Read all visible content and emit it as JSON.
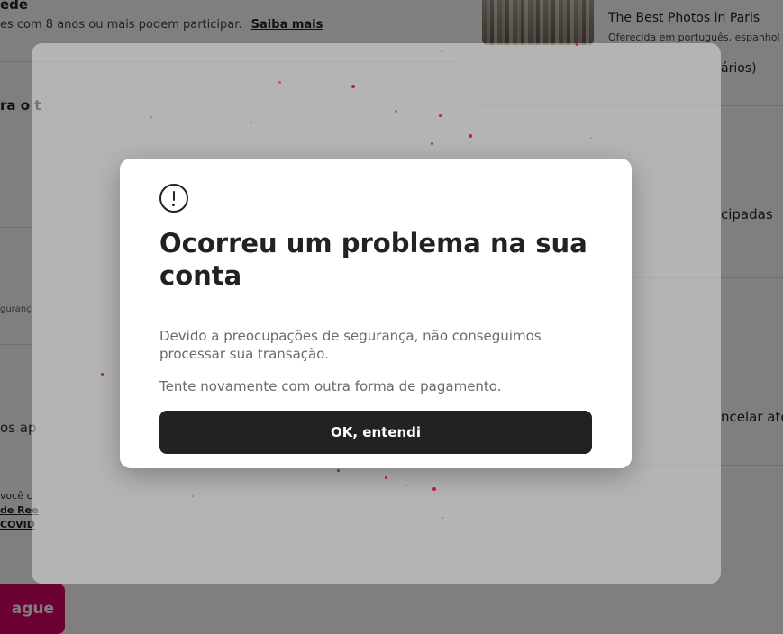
{
  "background": {
    "heading_top_left": "ede",
    "age_notice": "es com 8 anos ou mais podem participar.",
    "age_link": "Saiba mais",
    "section_heading_partial": "ra o t",
    "field_hint_partial": "guranç",
    "text_partial_1": "os ap",
    "footnote_1": "você c",
    "footnote_link_1": "de Ree",
    "footnote_link_2": "COVID",
    "listing_title": "The Best Photos in Paris",
    "listing_language": "Oferecida em português, espanhol",
    "listing_reviews_partial": "ários)",
    "right_text_1": "cipadas",
    "right_text_2": "ncelar até",
    "pay_button_label": "ague"
  },
  "modal": {
    "icon": "alert-circle-icon",
    "title": "Ocorreu um problema na sua conta",
    "body": "Devido a preocupações de segurança, não conseguimos processar sua transação.",
    "body2": "Tente novamente com outra forma de pagamento.",
    "ok_label": "OK, entendi"
  },
  "colors": {
    "brand_pink": "#d70466",
    "dot_color": "#c2185b",
    "button_dark": "#222222"
  }
}
